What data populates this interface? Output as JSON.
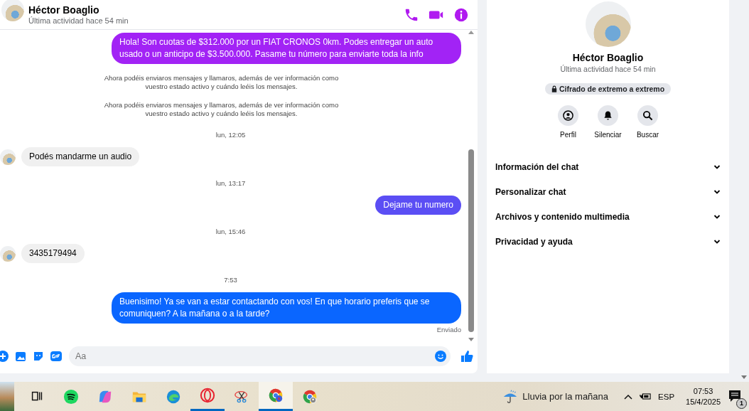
{
  "chat": {
    "header": {
      "name": "Héctor Boaglio",
      "status": "Última actividad hace 54 min"
    },
    "messages": [
      {
        "kind": "outgoing",
        "text": "Hola! Son cuotas de $312.000 por un FIAT CRONOS 0km. Podes entregar un auto usado o un anticipo de $3.500.000. Pasame tu número para enviarte toda la info",
        "color": "#a223f5"
      },
      {
        "kind": "notice",
        "text": "Ahora podéis enviaros mensajes y llamaros, además de ver información como vuestro estado activo y cuándo leéis los mensajes."
      },
      {
        "kind": "notice",
        "text": "Ahora podéis enviaros mensajes y llamaros, además de ver información como vuestro estado activo y cuándo leéis los mensajes."
      },
      {
        "kind": "time",
        "text": "lun, 12:05"
      },
      {
        "kind": "incoming",
        "text": "Podés mandarme un audio"
      },
      {
        "kind": "time",
        "text": "lun, 13:17"
      },
      {
        "kind": "outgoing",
        "text": "Dejame tu numero",
        "color": "#5b4ef4"
      },
      {
        "kind": "time",
        "text": "lun, 15:46"
      },
      {
        "kind": "incoming",
        "text": "3435179494"
      },
      {
        "kind": "time",
        "text": "7:53"
      },
      {
        "kind": "outgoing",
        "text": "Buenisimo! Ya se van a estar contactando con vos! En que horario preferis que se comuniquen? A la mañana o a la tarde?",
        "color": "#0a66ff"
      },
      {
        "kind": "receipt",
        "text": "Enviado"
      }
    ],
    "composer": {
      "placeholder": "Aa"
    }
  },
  "details": {
    "name": "Héctor Boaglio",
    "status": "Última actividad hace 54 min",
    "encryption": "Cifrado de extremo a extremo",
    "actions": [
      {
        "label": "Perfil"
      },
      {
        "label": "Silenciar"
      },
      {
        "label": "Buscar"
      }
    ],
    "sections": [
      {
        "label": "Información del chat",
        "expanded": false
      },
      {
        "label": "Personalizar chat",
        "expanded": false
      },
      {
        "label": "Archivos y contenido multimedia",
        "expanded": false
      },
      {
        "label": "Privacidad y ayuda",
        "expanded": false
      }
    ]
  },
  "taskbar": {
    "apps": [
      {
        "running": false,
        "selected": false
      },
      {
        "running": false,
        "selected": false
      },
      {
        "running": false,
        "selected": false
      },
      {
        "running": false,
        "selected": false
      },
      {
        "running": false,
        "selected": false
      },
      {
        "running": true,
        "selected": false
      },
      {
        "running": false,
        "selected": false
      },
      {
        "running": true,
        "selected": true
      },
      {
        "running": false,
        "selected": false
      }
    ],
    "weather": "Lluvia por la mañana",
    "language": "ESP",
    "time": "07:53",
    "date": "15/4/2025",
    "notifications": "1"
  }
}
